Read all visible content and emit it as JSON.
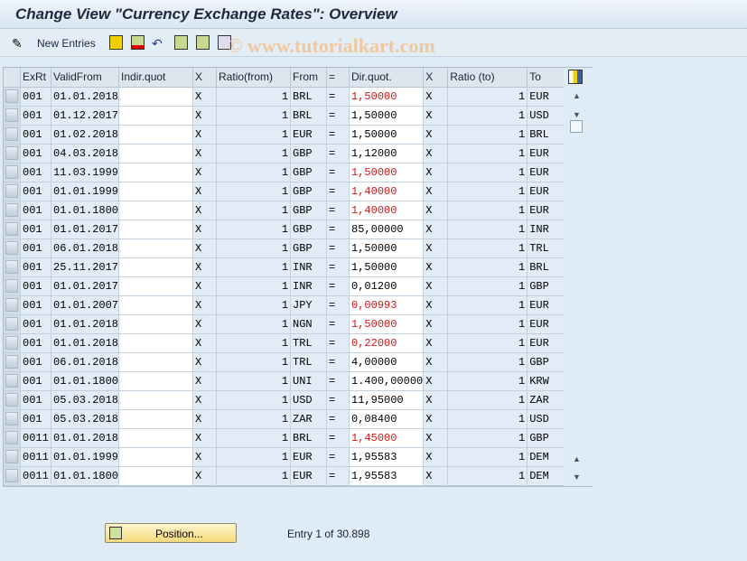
{
  "title": "Change View \"Currency Exchange Rates\": Overview",
  "toolbar": {
    "new_entries": "New Entries",
    "watermark": "© www.tutorialkart.com"
  },
  "columns": [
    "ExRt",
    "ValidFrom",
    "Indir.quot",
    "X",
    "Ratio(from)",
    "From",
    "=",
    "Dir.quot.",
    "X",
    "Ratio (to)",
    "To"
  ],
  "rows": [
    [
      "001",
      "01.01.2018",
      "",
      "X",
      "1",
      "BRL",
      "=",
      "1,50000",
      "X",
      "1",
      "EUR",
      true
    ],
    [
      "001",
      "01.12.2017",
      "",
      "X",
      "1",
      "BRL",
      "=",
      "1,50000",
      "X",
      "1",
      "USD",
      false
    ],
    [
      "001",
      "01.02.2018",
      "",
      "X",
      "1",
      "EUR",
      "=",
      "1,50000",
      "X",
      "1",
      "BRL",
      false
    ],
    [
      "001",
      "04.03.2018",
      "",
      "X",
      "1",
      "GBP",
      "=",
      "1,12000",
      "X",
      "1",
      "EUR",
      false
    ],
    [
      "001",
      "11.03.1999",
      "",
      "X",
      "1",
      "GBP",
      "=",
      "1,50000",
      "X",
      "1",
      "EUR",
      true
    ],
    [
      "001",
      "01.01.1999",
      "",
      "X",
      "1",
      "GBP",
      "=",
      "1,40000",
      "X",
      "1",
      "EUR",
      true
    ],
    [
      "001",
      "01.01.1800",
      "",
      "X",
      "1",
      "GBP",
      "=",
      "1,40000",
      "X",
      "1",
      "EUR",
      true
    ],
    [
      "001",
      "01.01.2017",
      "",
      "X",
      "1",
      "GBP",
      "=",
      "85,00000",
      "X",
      "1",
      "INR",
      false
    ],
    [
      "001",
      "06.01.2018",
      "",
      "X",
      "1",
      "GBP",
      "=",
      "1,50000",
      "X",
      "1",
      "TRL",
      false
    ],
    [
      "001",
      "25.11.2017",
      "",
      "X",
      "1",
      "INR",
      "=",
      "1,50000",
      "X",
      "1",
      "BRL",
      false
    ],
    [
      "001",
      "01.01.2017",
      "",
      "X",
      "1",
      "INR",
      "=",
      "0,01200",
      "X",
      "1",
      "GBP",
      false
    ],
    [
      "001",
      "01.01.2007",
      "",
      "X",
      "1",
      "JPY",
      "=",
      "0,00993",
      "X",
      "1",
      "EUR",
      true
    ],
    [
      "001",
      "01.01.2018",
      "",
      "X",
      "1",
      "NGN",
      "=",
      "1,50000",
      "X",
      "1",
      "EUR",
      true
    ],
    [
      "001",
      "01.01.2018",
      "",
      "X",
      "1",
      "TRL",
      "=",
      "0,22000",
      "X",
      "1",
      "EUR",
      true
    ],
    [
      "001",
      "06.01.2018",
      "",
      "X",
      "1",
      "TRL",
      "=",
      "4,00000",
      "X",
      "1",
      "GBP",
      false
    ],
    [
      "001",
      "01.01.1800",
      "",
      "X",
      "1",
      "UNI",
      "=",
      "1.400,00000",
      "X",
      "1",
      "KRW",
      false
    ],
    [
      "001",
      "05.03.2018",
      "",
      "X",
      "1",
      "USD",
      "=",
      "11,95000",
      "X",
      "1",
      "ZAR",
      false
    ],
    [
      "001",
      "05.03.2018",
      "",
      "X",
      "1",
      "ZAR",
      "=",
      "0,08400",
      "X",
      "1",
      "USD",
      false
    ],
    [
      "0011",
      "01.01.2018",
      "",
      "X",
      "1",
      "BRL",
      "=",
      "1,45000",
      "X",
      "1",
      "GBP",
      true
    ],
    [
      "0011",
      "01.01.1999",
      "",
      "X",
      "1",
      "EUR",
      "=",
      "1,95583",
      "X",
      "1",
      "DEM",
      false
    ],
    [
      "0011",
      "01.01.1800",
      "",
      "X",
      "1",
      "EUR",
      "=",
      "1,95583",
      "X",
      "1",
      "DEM",
      false
    ]
  ],
  "highlight_color": "#d01818",
  "footer": {
    "position_label": "Position...",
    "entry_text": "Entry 1 of 30.898"
  }
}
